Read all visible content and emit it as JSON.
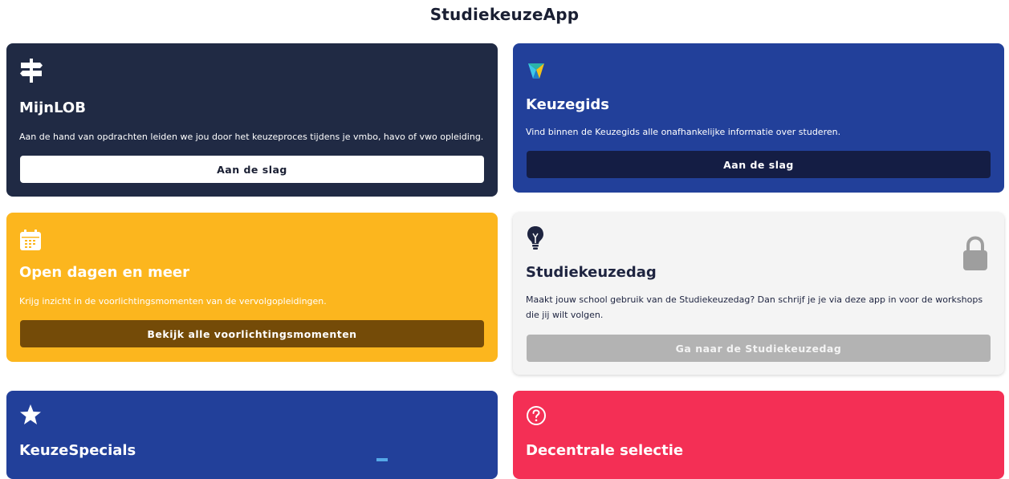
{
  "app": {
    "title": "StudiekeuzeApp"
  },
  "cards": [
    {
      "title": "MijnLOB",
      "description": "Aan de hand van opdrachten leiden we jou door het keuzeproces tijdens je vmbo, havo of vwo opleiding.",
      "button": "Aan de slag",
      "icon": "signpost-icon",
      "color": "#202a44"
    },
    {
      "title": "Keuzegids",
      "description": "Vind binnen de Keuzegids alle onafhankelijke informatie over studeren.",
      "button": "Aan de slag",
      "icon": "keuzegids-logo-icon",
      "color": "#22409a"
    },
    {
      "title": "Open dagen en meer",
      "description": "Krijg inzicht in de voorlichtingsmomenten van de vervolgopleidingen.",
      "button": "Bekijk alle voorlichtingsmomenten",
      "icon": "calendar-icon",
      "color": "#fcb61e"
    },
    {
      "title": "Studiekeuzedag",
      "description": "Maakt jouw school gebruik van de Studiekeuzedag? Dan schrijf je je via deze app in voor de workshops die jij wilt volgen.",
      "button": "Ga naar de Studiekeuzedag",
      "icon": "lightbulb-icon",
      "status_icon": "lock-icon",
      "color": "#f4f4f4",
      "locked": true
    },
    {
      "title": "KeuzeSpecials",
      "icon": "star-icon",
      "color": "#22409a"
    },
    {
      "title": "Decentrale selectie",
      "icon": "question-circle-icon",
      "color": "#f42f55"
    }
  ]
}
